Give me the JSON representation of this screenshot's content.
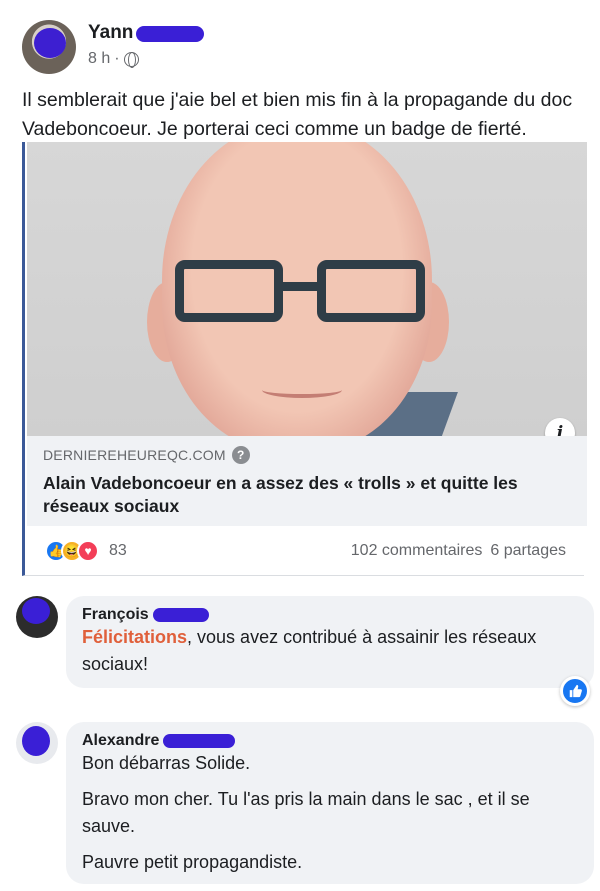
{
  "post": {
    "author": "Yann",
    "time": "8 h",
    "separator": "·",
    "text": "Il semblerait que j'aie bel et bien mis fin à la propagande du doc Vadeboncoeur. Je porterai ceci comme un badge de fierté.",
    "privacy_icon": "globe-icon"
  },
  "link": {
    "domain": "DERNIEREHEUREQC.COM",
    "title": "Alain Vadeboncoeur en a assez des « trolls » et quitte les réseaux sociaux",
    "info_icon": "i"
  },
  "stats": {
    "reaction_count": "83",
    "comments": "102 commentaires",
    "shares": "6 partages"
  },
  "comments": [
    {
      "author": "François",
      "highlight": "Félicitations",
      "text": ", vous avez contribué à assainir les réseaux sociaux!"
    },
    {
      "author": "Alexandre",
      "lines": [
        "Bon débarras Solide.",
        "Bravo mon cher. Tu l'as pris la main dans le sac , et il se sauve.",
        "Pauvre petit propagandiste."
      ]
    }
  ],
  "colors": {
    "accent": "#1877f2",
    "highlight": "#e0603b",
    "redaction": "#3a1fd6"
  }
}
